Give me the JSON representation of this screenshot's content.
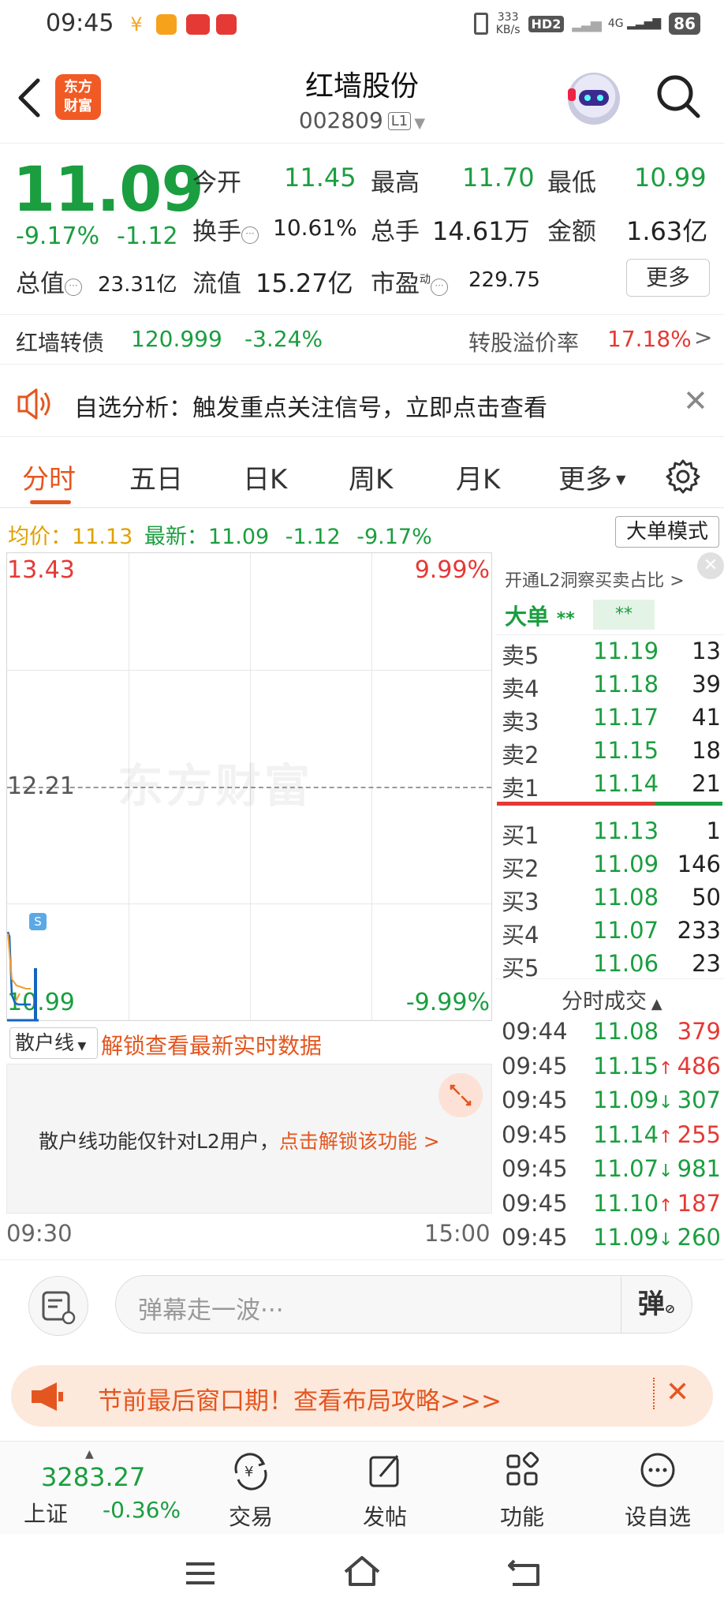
{
  "status": {
    "time": "09:45",
    "net_speed": "333\nKB/s",
    "hd": "HD2",
    "signal": "4G",
    "battery": "86"
  },
  "header": {
    "stock_name": "红墙股份",
    "stock_code": "002809",
    "level_badge": "L1",
    "logo_text": "东方\n财富"
  },
  "quote": {
    "price": "11.09",
    "change_pct": "-9.17%",
    "change": "-1.12",
    "open_label": "今开",
    "open": "11.45",
    "high_label": "最高",
    "high": "11.70",
    "low_label": "最低",
    "low": "10.99",
    "turnover_label": "换手",
    "turnover": "10.61%",
    "volume_label": "总手",
    "volume": "14.61万",
    "amount_label": "金额",
    "amount": "1.63亿",
    "mktcap_label": "总值",
    "mktcap": "23.31亿",
    "float_label": "流值",
    "float": "15.27亿",
    "pe_label": "市盈",
    "pe_sup": "动",
    "pe": "229.75",
    "more_label": "更多"
  },
  "bond": {
    "name": "红墙转债",
    "price": "120.999",
    "pct": "-3.24%",
    "premium_label": "转股溢价率",
    "premium": "17.18%"
  },
  "notice": {
    "text": "自选分析：触发重点关注信号，立即点击查看"
  },
  "tabs": [
    {
      "label": "分时"
    },
    {
      "label": "五日"
    },
    {
      "label": "日K"
    },
    {
      "label": "周K"
    },
    {
      "label": "月K"
    },
    {
      "label": "更多"
    }
  ],
  "avg": {
    "avg_label": "均价：",
    "avg": "11.13",
    "latest_label": "最新：",
    "latest": "11.09",
    "chg": "-1.12",
    "pct": "-9.17%",
    "big_order_mode": "大单模式"
  },
  "chart": {
    "top_price": "13.43",
    "top_pct": "9.99%",
    "mid_price": "12.21",
    "bottom_price": "10.99",
    "bottom_pct": "-9.99%",
    "start_time": "09:30",
    "end_time": "15:00",
    "marker": "S",
    "watermark": "东方财富"
  },
  "orderbook": {
    "promo": "开通L2洞察买卖占比",
    "big_label": "大单",
    "big_mask1": "**",
    "big_mask2": "**",
    "asks": [
      {
        "label": "卖5",
        "price": "11.19",
        "vol": "13"
      },
      {
        "label": "卖4",
        "price": "11.18",
        "vol": "39"
      },
      {
        "label": "卖3",
        "price": "11.17",
        "vol": "41"
      },
      {
        "label": "卖2",
        "price": "11.15",
        "vol": "18"
      },
      {
        "label": "卖1",
        "price": "11.14",
        "vol": "21"
      }
    ],
    "bids": [
      {
        "label": "买1",
        "price": "11.13",
        "vol": "1"
      },
      {
        "label": "买2",
        "price": "11.09",
        "vol": "146"
      },
      {
        "label": "买3",
        "price": "11.08",
        "vol": "50"
      },
      {
        "label": "买4",
        "price": "11.07",
        "vol": "233"
      },
      {
        "label": "买5",
        "price": "11.06",
        "vol": "23"
      }
    ],
    "ticks_title": "分时成交",
    "ticks": [
      {
        "time": "09:44",
        "price": "11.08",
        "arrow": "",
        "vol": "379",
        "color": "#e53935"
      },
      {
        "time": "09:45",
        "price": "11.15",
        "arrow": "↑",
        "vol": "486",
        "color": "#e53935"
      },
      {
        "time": "09:45",
        "price": "11.09",
        "arrow": "↓",
        "vol": "307",
        "color": "#1a9e3f"
      },
      {
        "time": "09:45",
        "price": "11.14",
        "arrow": "↑",
        "vol": "255",
        "color": "#e53935"
      },
      {
        "time": "09:45",
        "price": "11.07",
        "arrow": "↓",
        "vol": "981",
        "color": "#1a9e3f"
      },
      {
        "time": "09:45",
        "price": "11.10",
        "arrow": "↑",
        "vol": "187",
        "color": "#e53935"
      },
      {
        "time": "09:45",
        "price": "11.09",
        "arrow": "↓",
        "vol": "260",
        "color": "#1a9e3f"
      }
    ]
  },
  "retail": {
    "select_label": "散户线",
    "unlock_title": "解锁查看最新实时数据",
    "desc": "散户线功能仅针对L2用户，",
    "link": "点击解锁该功能 >"
  },
  "comment": {
    "placeholder": "弹幕走一波···",
    "danmu_label": "弹"
  },
  "promo": {
    "text": "节前最后窗口期！查看布局攻略>>>"
  },
  "bottom_nav": {
    "index_value": "3283.27",
    "index_name": "上证",
    "index_pct": "-0.36%",
    "items": [
      {
        "label": "交易",
        "icon": "yuan-exchange-icon"
      },
      {
        "label": "发帖",
        "icon": "edit-icon"
      },
      {
        "label": "功能",
        "icon": "grid-icon"
      },
      {
        "label": "设自选",
        "icon": "more-dots-icon"
      }
    ]
  }
}
